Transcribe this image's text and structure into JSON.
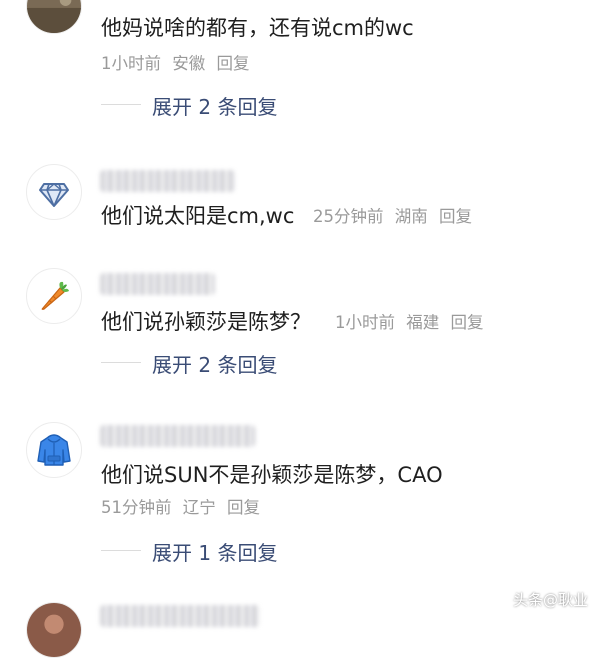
{
  "comments": [
    {
      "text": "他妈说啥的都有，还有说cm的wc",
      "time": "1小时前",
      "location": "安徽",
      "reply_label": "回复",
      "expand_label": "展开 2 条回复",
      "avatar_icon": "landscape-photo-icon"
    },
    {
      "text": "他们说太阳是cm,wc",
      "time": "25分钟前",
      "location": "湖南",
      "reply_label": "回复",
      "avatar_icon": "diamond-icon"
    },
    {
      "text": "他们说孙颖莎是陈梦？",
      "time": "1小时前",
      "location": "福建",
      "reply_label": "回复",
      "expand_label": "展开 2 条回复",
      "avatar_icon": "carrot-icon"
    },
    {
      "text": "他们说SUN不是孙颖莎是陈梦，CAO",
      "time": "51分钟前",
      "location": "辽宁",
      "reply_label": "回复",
      "expand_label": "展开 1 条回复",
      "avatar_icon": "hoodie-icon"
    }
  ],
  "watermark": "头条@耿业",
  "colors": {
    "link": "#3a4c75",
    "meta": "#9a9a9a",
    "text": "#1f1f1f"
  }
}
